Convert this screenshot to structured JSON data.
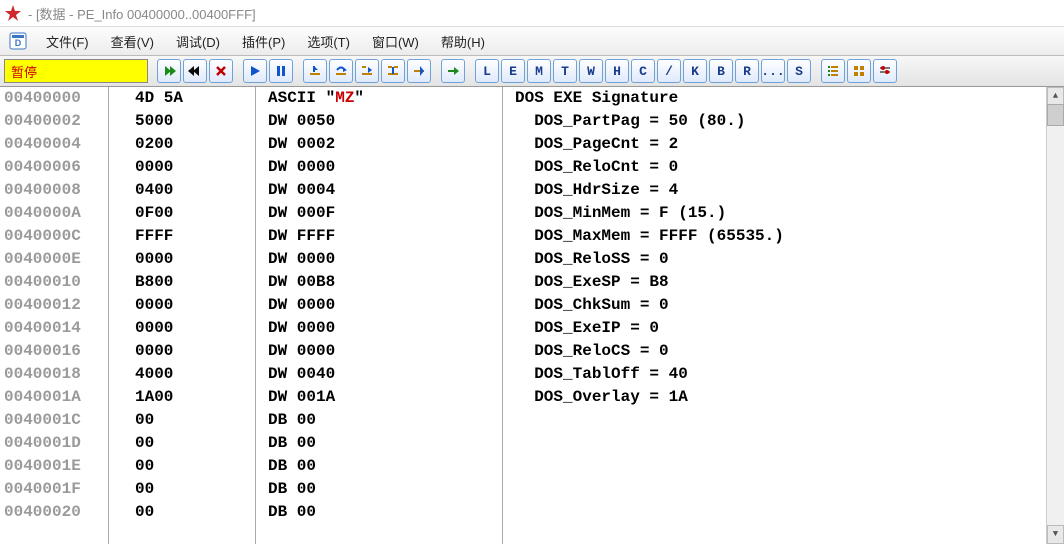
{
  "title": " - [数据 - PE_Info 00400000..00400FFF]",
  "menu": {
    "file": "文件(F)",
    "view": "查看(V)",
    "debug": "调试(D)",
    "plugins": "插件(P)",
    "options": "选项(T)",
    "window": "窗口(W)",
    "help": "帮助(H)"
  },
  "toolbar": {
    "pause": "暂停",
    "letters": [
      "L",
      "E",
      "M",
      "T",
      "W",
      "H",
      "C",
      "/",
      "K",
      "B",
      "R",
      "...",
      "S"
    ]
  },
  "rows": [
    {
      "addr": "00400000",
      "hex": "4D 5A",
      "asm": "ASCII \"MZ\"",
      "desc": "DOS EXE Signature"
    },
    {
      "addr": "00400002",
      "hex": "5000",
      "asm": "DW 0050",
      "desc": "  DOS_PartPag = 50 (80.)"
    },
    {
      "addr": "00400004",
      "hex": "0200",
      "asm": "DW 0002",
      "desc": "  DOS_PageCnt = 2"
    },
    {
      "addr": "00400006",
      "hex": "0000",
      "asm": "DW 0000",
      "desc": "  DOS_ReloCnt = 0"
    },
    {
      "addr": "00400008",
      "hex": "0400",
      "asm": "DW 0004",
      "desc": "  DOS_HdrSize = 4"
    },
    {
      "addr": "0040000A",
      "hex": "0F00",
      "asm": "DW 000F",
      "desc": "  DOS_MinMem = F (15.)"
    },
    {
      "addr": "0040000C",
      "hex": "FFFF",
      "asm": "DW FFFF",
      "desc": "  DOS_MaxMem = FFFF (65535.)"
    },
    {
      "addr": "0040000E",
      "hex": "0000",
      "asm": "DW 0000",
      "desc": "  DOS_ReloSS = 0"
    },
    {
      "addr": "00400010",
      "hex": "B800",
      "asm": "DW 00B8",
      "desc": "  DOS_ExeSP = B8"
    },
    {
      "addr": "00400012",
      "hex": "0000",
      "asm": "DW 0000",
      "desc": "  DOS_ChkSum = 0"
    },
    {
      "addr": "00400014",
      "hex": "0000",
      "asm": "DW 0000",
      "desc": "  DOS_ExeIP = 0"
    },
    {
      "addr": "00400016",
      "hex": "0000",
      "asm": "DW 0000",
      "desc": "  DOS_ReloCS = 0"
    },
    {
      "addr": "00400018",
      "hex": "4000",
      "asm": "DW 0040",
      "desc": "  DOS_TablOff = 40"
    },
    {
      "addr": "0040001A",
      "hex": "1A00",
      "asm": "DW 001A",
      "desc": "  DOS_Overlay = 1A"
    },
    {
      "addr": "0040001C",
      "hex": "00",
      "asm": "DB 00",
      "desc": ""
    },
    {
      "addr": "0040001D",
      "hex": "00",
      "asm": "DB 00",
      "desc": ""
    },
    {
      "addr": "0040001E",
      "hex": "00",
      "asm": "DB 00",
      "desc": ""
    },
    {
      "addr": "0040001F",
      "hex": "00",
      "asm": "DB 00",
      "desc": ""
    },
    {
      "addr": "00400020",
      "hex": "00",
      "asm": "DB 00",
      "desc": ""
    }
  ]
}
